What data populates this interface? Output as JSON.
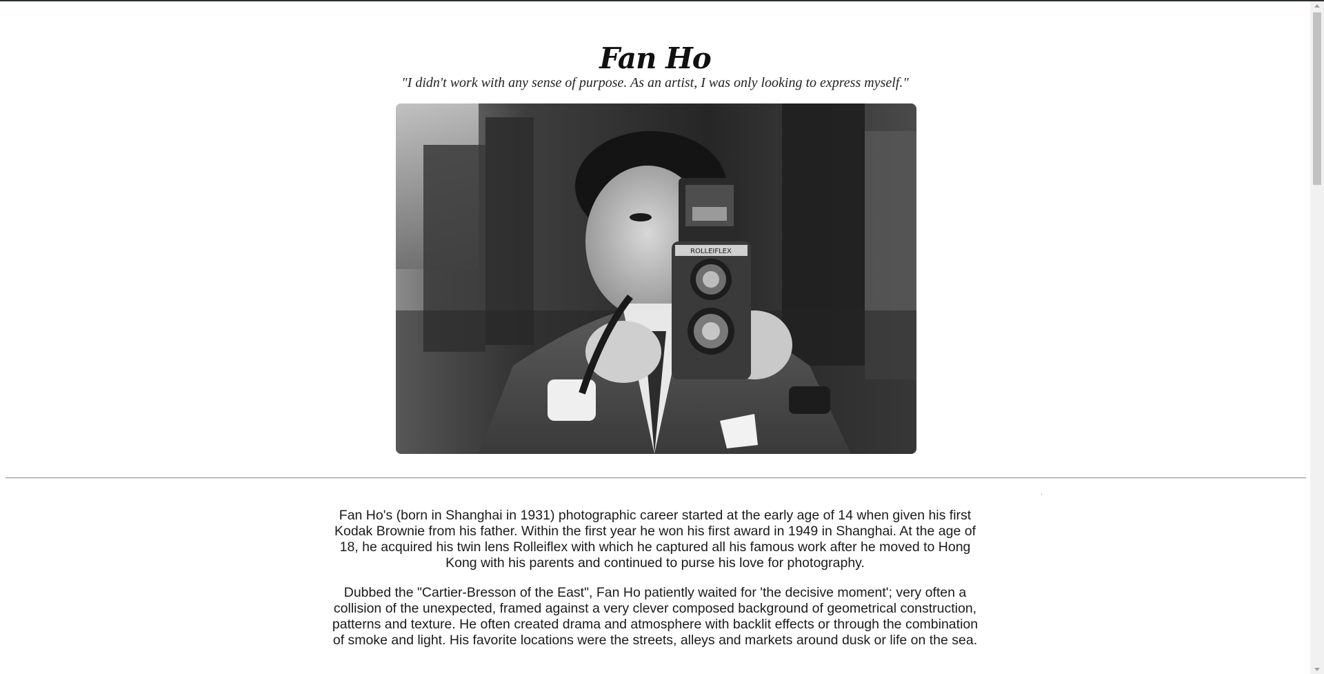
{
  "page": {
    "title": "Fan Ho",
    "quote": "\"I didn't work with any sense of purpose. As an artist, I was only looking to express myself.\"",
    "image": {
      "description_icon": "photo-portrait-with-camera-icon",
      "camera_brand": "ROLLEIFLEX"
    },
    "bio": [
      "Fan Ho's (born in Shanghai in 1931) photographic career started at the early age of 14 when given his first Kodak Brownie from his father. Within the first year he won his first award in 1949 in Shanghai. At the age of 18, he acquired his twin lens Rolleiflex with which he captured all his famous work after he moved to Hong Kong with his parents and continued to purse his love for photography.",
      "Dubbed the \"Cartier-Bresson of the East\", Fan Ho patiently waited for 'the decisive moment'; very often a collision of the unexpected, framed against a very clever composed background of geometrical construction, patterns and texture. He often created drama and atmosphere with backlit effects or through the combination of smoke and light. His favorite locations were the streets, alleys and markets around dusk or life on the sea."
    ]
  },
  "colors": {
    "background": "#ffffff",
    "text": "#1a1a1a",
    "divider": "#9a9a9a",
    "scrollbar_track": "#f1f1f1",
    "scrollbar_thumb": "#c1c1c1"
  }
}
